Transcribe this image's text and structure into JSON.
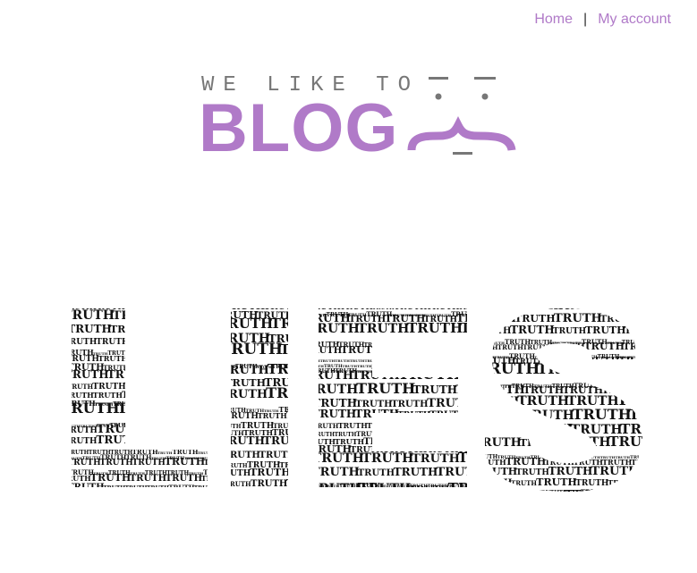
{
  "nav": {
    "home_label": "Home",
    "separator": "|",
    "account_label": "My account"
  },
  "logo": {
    "tagline": "WE LIKE TO",
    "title": "BLOG"
  },
  "hero": {
    "words_letters": [
      "L",
      "I",
      "E",
      "S"
    ],
    "fill_word": "TRUTH"
  },
  "colors": {
    "accent": "#b07ac8",
    "tagline_gray": "#777777",
    "face_gray": "#777777",
    "text": "#111111"
  }
}
